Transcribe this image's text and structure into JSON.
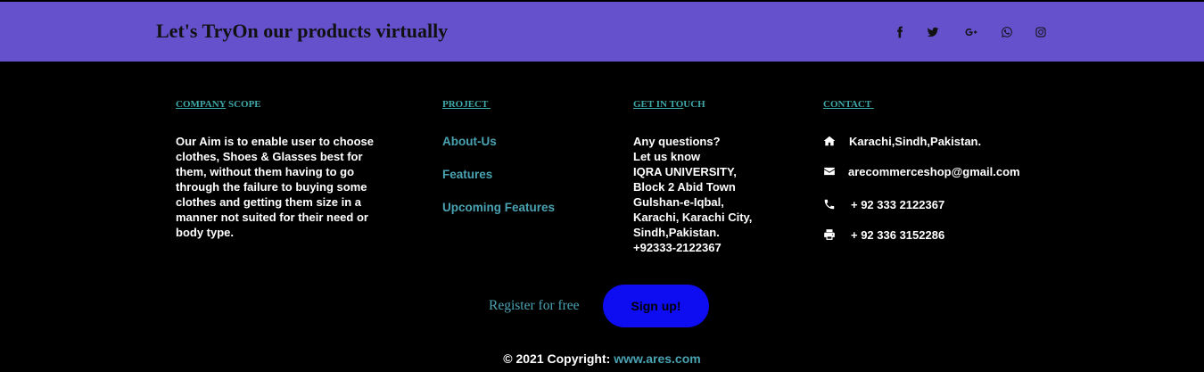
{
  "header": {
    "tagline": "Let's TryOn our products virtually",
    "social_icons": [
      "facebook-icon",
      "twitter-icon",
      "google-plus-icon",
      "whatsapp-icon",
      "instagram-icon"
    ]
  },
  "company_scope": {
    "heading_a": "COMPANY",
    "heading_b": " SCOPE",
    "text": "Our Aim is to enable user to choose clothes, Shoes & Glasses best for them, without them having to go through the failure to buying some clothes and getting them size in a manner not suited for their need or body type."
  },
  "project": {
    "heading": "PROJECT ",
    "links": [
      "About-Us",
      "Features",
      "Upcoming Features"
    ]
  },
  "get_in_touch": {
    "heading_a": "GET IN TO",
    "heading_b": "UCH",
    "lines": [
      "Any questions?",
      "Let us know",
      "IQRA UNIVERSITY,",
      "Block 2 Abid Town",
      "Gulshan-e-Iqbal,",
      "Karachi, Karachi City,",
      "Sindh,Pakistan.",
      "+92333-2122367"
    ]
  },
  "contact": {
    "heading": "CONTACT ",
    "address": "Karachi,Sindh,Pakistan.",
    "email": "arecommerceshop@gmail.com",
    "phone": "+ 92 333 2122367",
    "fax": "+ 92 336 3152286"
  },
  "cta": {
    "register_text": "Register for free",
    "signup_label": "Sign up!"
  },
  "footer": {
    "copyright_prefix": "© 2021 Copyright: ",
    "copyright_link": "www.ares.com"
  },
  "colors": {
    "header_band": "#6651cc",
    "accent_teal": "#4aa3b3",
    "signup_button": "#0e0cf0",
    "background": "#000000"
  }
}
